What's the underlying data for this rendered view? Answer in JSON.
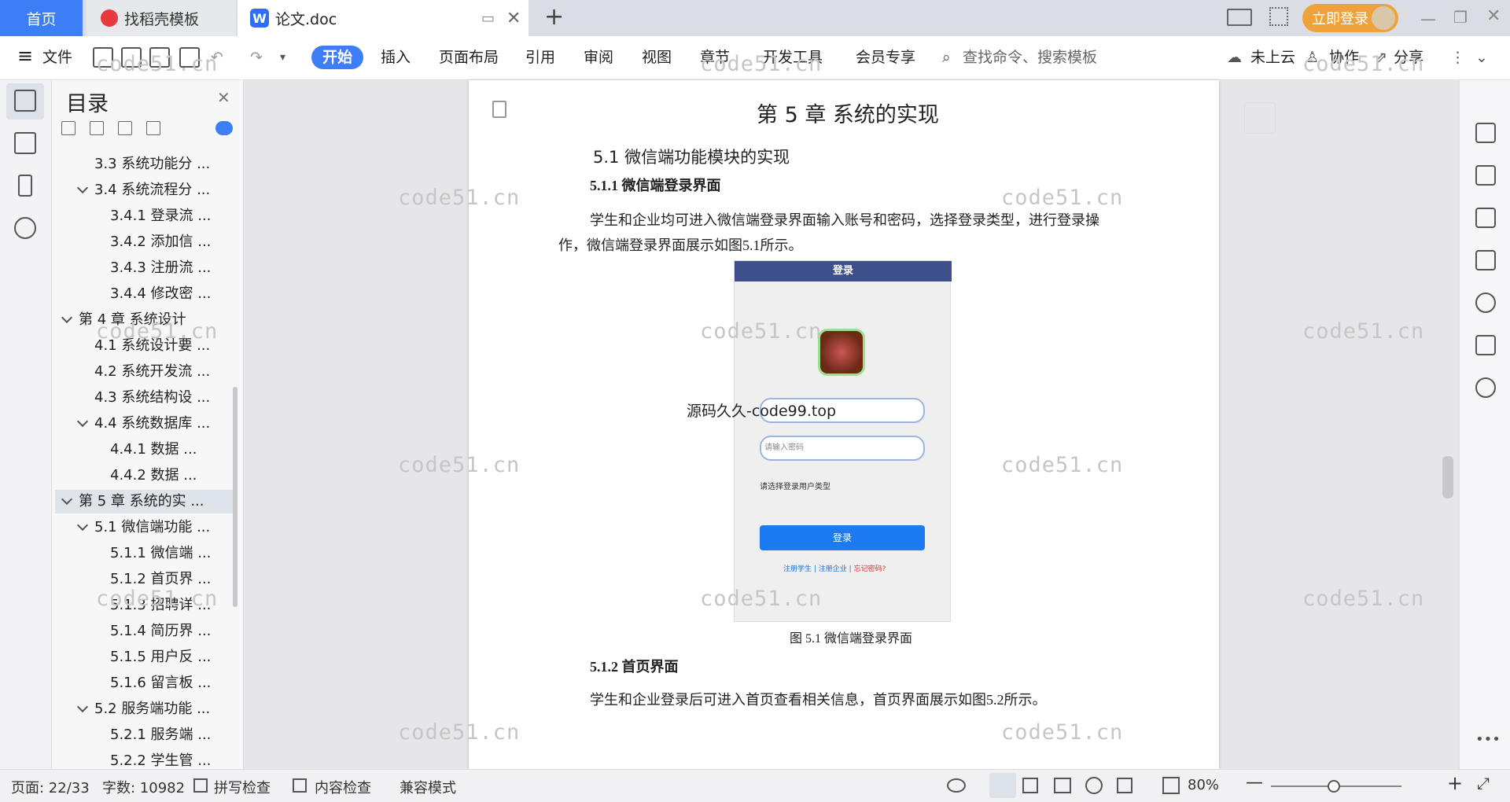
{
  "titlebar": {
    "tabs": [
      {
        "label": "首页"
      },
      {
        "label": "找稻壳模板"
      },
      {
        "label": "论文.doc"
      }
    ],
    "login_label": "立即登录"
  },
  "toolbar": {
    "file_label": "文件",
    "ribbon_tabs": [
      "开始",
      "插入",
      "页面布局",
      "引用",
      "审阅",
      "视图",
      "章节",
      "开发工具",
      "会员专享"
    ],
    "search_placeholder": "查找命令、搜索模板",
    "cloud_label": "未上云",
    "collab_label": "协作",
    "share_label": "分享"
  },
  "toc": {
    "title": "目录",
    "items": [
      {
        "label": "3.3  系统功能分 ..."
      },
      {
        "label": "3.4  系统流程分 ..."
      },
      {
        "label": "3.4.1  登录流 ..."
      },
      {
        "label": "3.4.2  添加信 ..."
      },
      {
        "label": "3.4.3  注册流 ..."
      },
      {
        "label": "3.4.4  修改密 ..."
      },
      {
        "label": "第 4 章   系统设计"
      },
      {
        "label": "4.1 系统设计要 ..."
      },
      {
        "label": "4.2 系统开发流 ..."
      },
      {
        "label": "4.3 系统结构设 ..."
      },
      {
        "label": "4.4 系统数据库 ..."
      },
      {
        "label": "4.4.1  数据 ..."
      },
      {
        "label": "4.4.2  数据 ..."
      },
      {
        "label": "第 5 章  系统的实 ..."
      },
      {
        "label": "5.1 微信端功能 ..."
      },
      {
        "label": "5.1.1 微信端 ..."
      },
      {
        "label": "5.1.2 首页界 ..."
      },
      {
        "label": "5.1.3 招聘详 ..."
      },
      {
        "label": "5.1.4 简历界 ..."
      },
      {
        "label": "5.1.5 用户反 ..."
      },
      {
        "label": "5.1.6 留言板 ..."
      },
      {
        "label": "5.2 服务端功能 ..."
      },
      {
        "label": "5.2.1 服务端 ..."
      },
      {
        "label": "5.2.2 学生管 ..."
      }
    ]
  },
  "document": {
    "chapter_title": "第 5 章  系统的实现",
    "section_title": "5.1 微信端功能模块的实现",
    "subsection_1": "5.1.1 微信端登录界面",
    "para_1a": "学生和企业均可进入微信端登录界面输入账号和密码，选择登录类型，进行登录操",
    "para_1b": "作，微信端登录界面展示如图5.1所示。",
    "figure_caption": "图 5.1  微信端登录界面",
    "subsection_2": "5.1.2 首页界面",
    "para_2": "学生和企业登录后可进入首页查看相关信息，首页界面展示如图5.2所示。",
    "overlay_text": "源码久久-code99.top",
    "watermark": "code51.cn"
  },
  "phone": {
    "header": "登录",
    "password_placeholder": "请输入密码",
    "type_label": "请选择登录用户类型",
    "login_button": "登录",
    "link_student": "注册学生",
    "link_company": "注册企业",
    "link_forgot": "忘记密码?"
  },
  "status": {
    "page": "页面: 22/33",
    "words": "字数: 10982",
    "spell": "拼写检查",
    "content_check": "内容检查",
    "compat": "兼容模式",
    "zoom": "80%"
  }
}
